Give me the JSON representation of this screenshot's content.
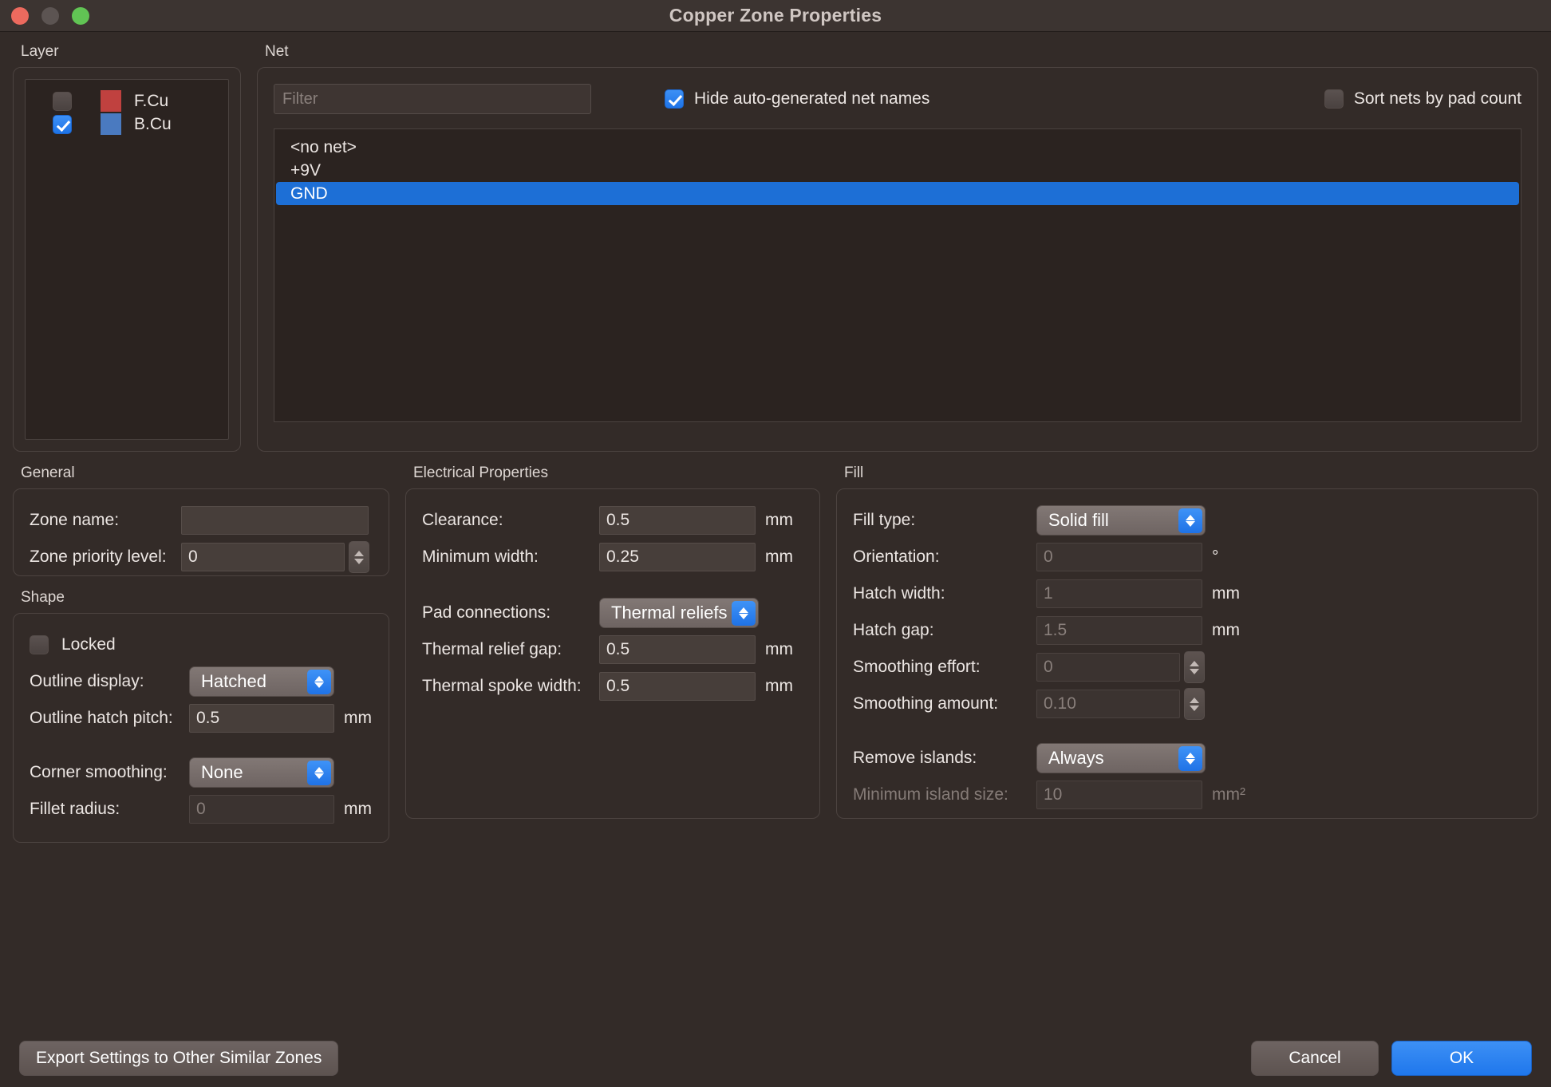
{
  "window": {
    "title": "Copper Zone Properties",
    "traffic_lights": [
      "close",
      "minimize",
      "zoom"
    ]
  },
  "layer": {
    "group_label": "Layer",
    "items": [
      {
        "name": "F.Cu",
        "checked": false,
        "color": "#c0413f"
      },
      {
        "name": "B.Cu",
        "checked": true,
        "color": "#4a7ac0"
      }
    ]
  },
  "net": {
    "group_label": "Net",
    "filter_placeholder": "Filter",
    "filter_value": "",
    "hide_autogen_label": "Hide auto-generated net names",
    "hide_autogen_checked": true,
    "sort_by_pad_label": "Sort nets by pad count",
    "sort_by_pad_checked": false,
    "items": [
      "<no net>",
      "+9V",
      "GND"
    ],
    "selected": "GND"
  },
  "general": {
    "group_label": "General",
    "zone_name_label": "Zone name:",
    "zone_name_value": "",
    "zone_priority_label": "Zone priority level:",
    "zone_priority_value": "0"
  },
  "shape": {
    "group_label": "Shape",
    "locked_label": "Locked",
    "locked_checked": false,
    "outline_display_label": "Outline display:",
    "outline_display_value": "Hatched",
    "outline_hatch_pitch_label": "Outline hatch pitch:",
    "outline_hatch_pitch_value": "0.5",
    "outline_hatch_pitch_unit": "mm",
    "corner_smoothing_label": "Corner smoothing:",
    "corner_smoothing_value": "None",
    "fillet_radius_label": "Fillet radius:",
    "fillet_radius_value": "0",
    "fillet_radius_unit": "mm"
  },
  "electrical": {
    "group_label": "Electrical Properties",
    "clearance_label": "Clearance:",
    "clearance_value": "0.5",
    "clearance_unit": "mm",
    "min_width_label": "Minimum width:",
    "min_width_value": "0.25",
    "min_width_unit": "mm",
    "pad_connections_label": "Pad connections:",
    "pad_connections_value": "Thermal reliefs",
    "thermal_relief_gap_label": "Thermal relief gap:",
    "thermal_relief_gap_value": "0.5",
    "thermal_relief_gap_unit": "mm",
    "thermal_spoke_width_label": "Thermal spoke width:",
    "thermal_spoke_width_value": "0.5",
    "thermal_spoke_width_unit": "mm"
  },
  "fill": {
    "group_label": "Fill",
    "fill_type_label": "Fill type:",
    "fill_type_value": "Solid fill",
    "orientation_label": "Orientation:",
    "orientation_value": "0",
    "orientation_unit": "°",
    "hatch_width_label": "Hatch width:",
    "hatch_width_value": "1",
    "hatch_width_unit": "mm",
    "hatch_gap_label": "Hatch gap:",
    "hatch_gap_value": "1.5",
    "hatch_gap_unit": "mm",
    "smoothing_effort_label": "Smoothing effort:",
    "smoothing_effort_value": "0",
    "smoothing_amount_label": "Smoothing amount:",
    "smoothing_amount_value": "0.10",
    "remove_islands_label": "Remove islands:",
    "remove_islands_value": "Always",
    "min_island_size_label": "Minimum island size:",
    "min_island_size_value": "10",
    "min_island_size_unit": "mm²"
  },
  "footer": {
    "export_label": "Export Settings to Other Similar Zones",
    "cancel_label": "Cancel",
    "ok_label": "OK"
  },
  "colors": {
    "accent_blue": "#1d6fd6",
    "window_bg": "#332b28",
    "panel_bg": "#2b2320"
  }
}
